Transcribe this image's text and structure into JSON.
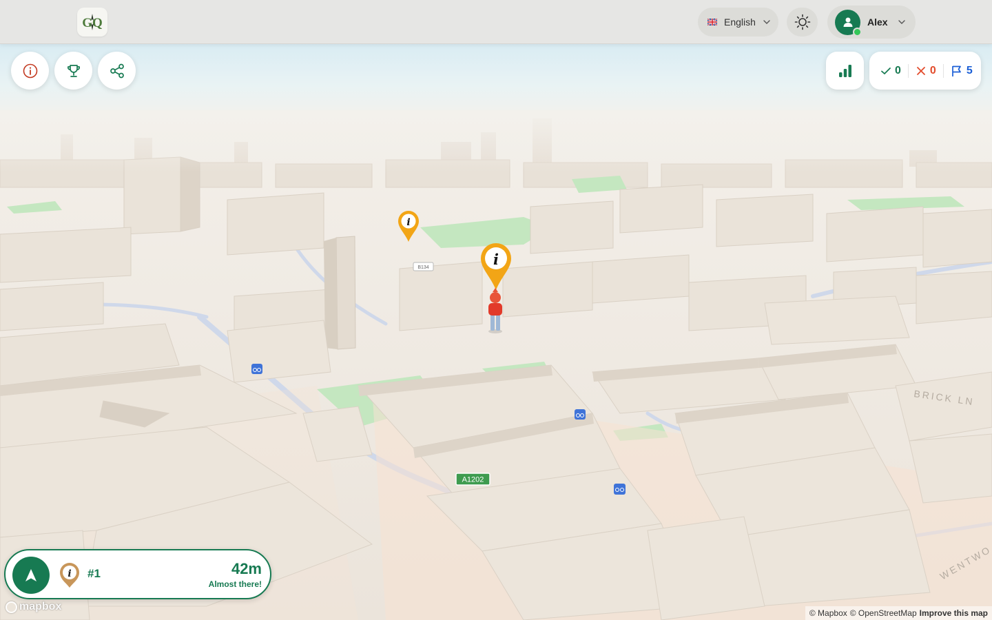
{
  "header": {
    "logo_text": "GQ",
    "language": {
      "label": "English",
      "flag_icon": "uk-flag-icon"
    },
    "theme_icon": "sun-icon",
    "user": {
      "name": "Alex",
      "status": "online"
    }
  },
  "toolbar_left": [
    {
      "name": "info-button",
      "icon": "info-icon"
    },
    {
      "name": "leaderboard-button",
      "icon": "trophy-icon"
    },
    {
      "name": "share-button",
      "icon": "share-icon"
    }
  ],
  "stats_button_icon": "bar-chart-icon",
  "score": {
    "correct": "0",
    "wrong": "0",
    "flags": "5"
  },
  "map": {
    "labels": {
      "b134": "B134",
      "a1202": "A1202",
      "brick_ln": "BRICK LN",
      "wentworth": "WENTWO"
    },
    "markers": [
      "info-marker",
      "info-marker-selected",
      "player-avatar",
      "bike-station",
      "bike-station",
      "bike-station"
    ]
  },
  "navigation": {
    "rank": "#1",
    "distance": "42m",
    "status": "Almost there!"
  },
  "attribution": {
    "mapbox": "© Mapbox",
    "osm": "© OpenStreetMap",
    "improve": "Improve this map"
  },
  "mapbox_logo": "mapbox",
  "colors": {
    "brand_green": "#177a52",
    "marker_orange": "#f2a516",
    "wrong_red": "#e24b2b",
    "flag_blue": "#1b5fd6"
  }
}
